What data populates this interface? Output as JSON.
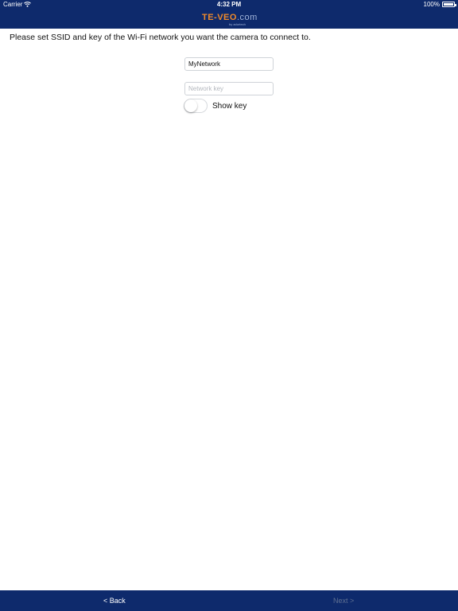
{
  "status_bar": {
    "carrier": "Carrier",
    "wifi_icon": "wifi-icon",
    "time": "4:32 PM",
    "battery": "100%"
  },
  "header": {
    "logo_main": "TE-VEO",
    "logo_com": ".com",
    "logo_sub": "by adurtech",
    "brand_color": "#f08a2a",
    "bar_color": "#0e2a6c"
  },
  "main": {
    "instruction": "Please set SSID and key of the Wi-Fi network you want the camera to connect to.",
    "ssid_value": "MyNetwork",
    "key_placeholder": "Network key",
    "key_value": "",
    "show_key_label": "Show key",
    "show_key_on": false
  },
  "footer": {
    "back_label": "< Back",
    "next_label": "Next >"
  }
}
